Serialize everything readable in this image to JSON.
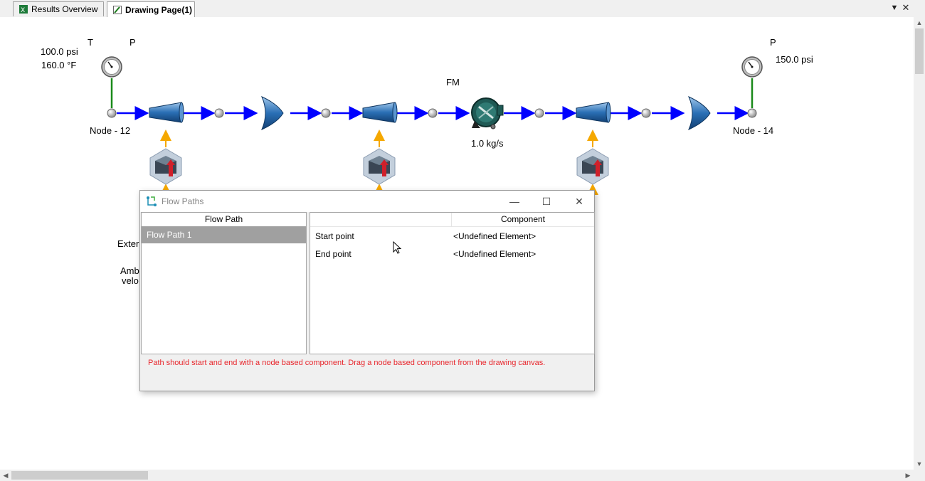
{
  "tabs": [
    {
      "label": "Results Overview",
      "active": false
    },
    {
      "label": "Drawing Page(1)",
      "active": true
    }
  ],
  "diagram": {
    "inlet": {
      "t_label": "T",
      "p_label": "P",
      "pressure": "100.0 psi",
      "temperature": "160.0 °F",
      "node": "Node - 12"
    },
    "outlet": {
      "p_label": "P",
      "pressure": "150.0 psi",
      "node": "Node - 14"
    },
    "flow_meter": {
      "label": "FM",
      "flow": "1.0 kg/s"
    },
    "partial_labels": {
      "external": "Exter",
      "ambient_1": "Amb",
      "ambient_2": "velo"
    },
    "colors": {
      "pipe": "#0000ff",
      "heat_arrow": "#f5a800",
      "gauge_stem": "#1a8a1a"
    }
  },
  "dialog": {
    "title": "Flow Paths",
    "left_header": "Flow Path",
    "paths": [
      "Flow Path 1"
    ],
    "right_header": "Component",
    "rows": [
      {
        "label": "Start point",
        "value": "<Undefined Element>"
      },
      {
        "label": "End point",
        "value": "<Undefined Element>"
      }
    ],
    "message": "Path should start and end with a node based component. Drag a node based component from the drawing canvas.",
    "message_color": "#e8262c"
  },
  "icons": [
    "excel-icon",
    "drawing-icon",
    "flow-paths-icon",
    "gauge-icon",
    "nozzle-icon",
    "diffuser-icon",
    "flowmeter-icon",
    "heat-source-icon"
  ]
}
